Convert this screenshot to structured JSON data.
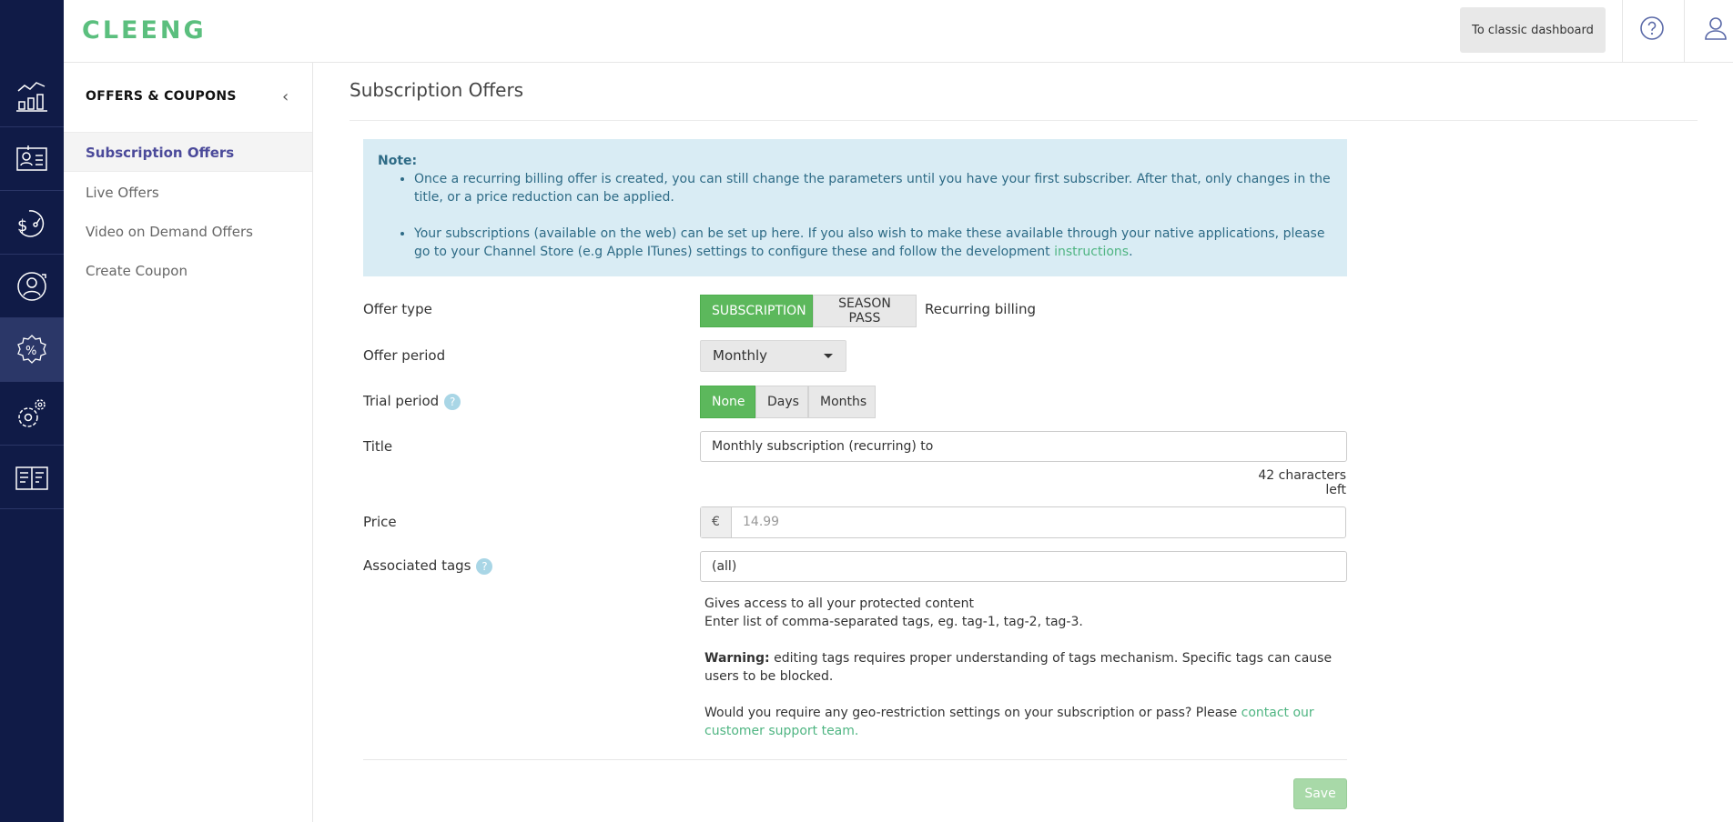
{
  "brand": {
    "logo_text": "cleeng",
    "accent": "#5bbf7e",
    "iconbar_bg": "#101b47"
  },
  "header": {
    "classic_button": "To classic dashboard",
    "icons": [
      "help-icon",
      "user-icon"
    ]
  },
  "iconbar": {
    "items": [
      {
        "name": "analytics-icon"
      },
      {
        "name": "customers-icon"
      },
      {
        "name": "revenue-icon"
      },
      {
        "name": "retention-icon"
      },
      {
        "name": "offers-icon",
        "active": true
      },
      {
        "name": "settings-icon"
      },
      {
        "name": "docs-icon"
      }
    ]
  },
  "subnav": {
    "title": "OFFERS & COUPONS",
    "items": [
      {
        "label": "Subscription Offers",
        "active": true
      },
      {
        "label": "Live Offers"
      },
      {
        "label": "Video on Demand Offers"
      },
      {
        "label": "Create Coupon"
      }
    ]
  },
  "main": {
    "title": "Subscription Offers",
    "note": {
      "label": "Note:",
      "bullet1": "Once a recurring billing offer is created, you can still change the parameters until you have your first subscriber. After that, only changes in the title, or a price reduction can be applied.",
      "bullet2_prefix": "Your subscriptions (available on the web) can be set up here. If you also wish to make these available through your native applications, please go to your Channel Store (e.g Apple ITunes) settings to configure these and follow the development ",
      "bullet2_link": "instructions",
      "bullet2_suffix": "."
    },
    "form": {
      "offer_type": {
        "label": "Offer type",
        "options": [
          "SUBSCRIPTION",
          "SEASON PASS"
        ],
        "selected": "SUBSCRIPTION",
        "hint": "Recurring billing"
      },
      "offer_period": {
        "label": "Offer period",
        "value": "Monthly"
      },
      "trial_period": {
        "label": "Trial period",
        "options": [
          "None",
          "Days",
          "Months"
        ],
        "selected": "None"
      },
      "title": {
        "label": "Title",
        "value": "Monthly subscription (recurring) to",
        "counter": "42 characters left"
      },
      "price": {
        "label": "Price",
        "currency": "€",
        "placeholder": "14.99"
      },
      "tags": {
        "label": "Associated tags",
        "value": "(all)"
      },
      "help": {
        "line1": "Gives access to all your protected content",
        "line2": "Enter list of comma-separated tags, eg. tag-1, tag-2, tag-3.",
        "warning_label": "Warning:",
        "warning_text": " editing tags requires proper understanding of tags mechanism. Specific tags can cause users to be blocked.",
        "geo_text": "Would you require any geo-restriction settings on your subscription or pass? Please ",
        "geo_link": "contact our customer support team."
      },
      "save_label": "Save"
    }
  }
}
